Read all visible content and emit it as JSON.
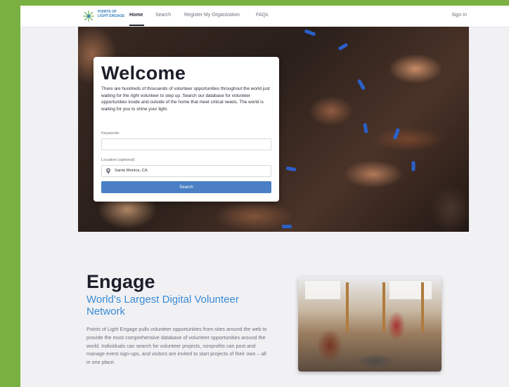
{
  "header": {
    "logo_text": "POINTS OF LIGHT ENGAGE",
    "nav": [
      {
        "label": "Home",
        "active": true
      },
      {
        "label": "Search",
        "active": false
      },
      {
        "label": "Register My Organization",
        "active": false
      },
      {
        "label": "FAQs",
        "active": false
      }
    ],
    "sign_in": "Sign In"
  },
  "hero": {
    "title": "Welcome",
    "description": "There are hundreds of thousands of volunteer opportunities throughout the world just waiting for the right volunteer to step up. Search our database for volunteer opportunities inside and outside of the home that meet critical needs. The world is waiting for you to shine your light.",
    "keywords_label": "Keywords",
    "keywords_value": "",
    "location_label": "Location (optional)",
    "location_value": "Santa Monica, CA",
    "search_label": "Search"
  },
  "engage": {
    "title": "Engage",
    "subtitle": "World's Largest Digital Volunteer Network",
    "description": "Points of Light Engage pulls volunteer opportunities from sites around the web to provide the most comprehensive database of volunteer opportunities around the world. Individuals can search for volunteer projects, nonprofits can post and manage event sign-ups, and visitors are invited to start projects of their own – all in one place."
  },
  "colors": {
    "accent": "#3a8bd4",
    "button": "#4a7fc4",
    "outer_background": "#7ab041"
  },
  "icons": [
    "logo-mark-icon",
    "location-pin-icon"
  ]
}
